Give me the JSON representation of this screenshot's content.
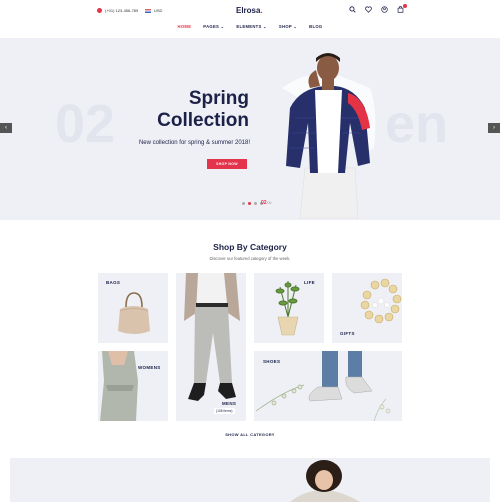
{
  "topbar": {
    "phone": "(+01) 123-456-789",
    "currency": "USD"
  },
  "brand": {
    "name": "Elrosa",
    "dot": "."
  },
  "header_icons": [
    "search-icon",
    "heart-icon",
    "user-icon",
    "cart-icon"
  ],
  "nav": [
    {
      "label": "HOME",
      "active": true
    },
    {
      "label": "PAGES ⌄"
    },
    {
      "label": "ELEMENTS ⌄"
    },
    {
      "label": "SHOP ⌄"
    },
    {
      "label": "BLOG"
    }
  ],
  "hero": {
    "bg_left": "02",
    "bg_right": "en",
    "title_line1": "Spring",
    "title_line2": "Collection",
    "subtitle": "New collection for spring & summer 2018!",
    "button": "SHOP NOW",
    "page_current": "02",
    "page_total": "/06"
  },
  "category": {
    "title": "Shop By Category",
    "subtitle": "Discover our featured category of the week.",
    "tiles": {
      "bags": "BAGS",
      "life": "LIFE",
      "gifts": "GIFTS",
      "women": "WOMENS",
      "shoes": "SHOES",
      "mens": "MENS",
      "mens_items": "(108 items)"
    },
    "show_all": "SHOW ALL CATEGORY"
  },
  "colors": {
    "accent": "#e4344b",
    "navy": "#1c2147",
    "panel": "#eef0f6"
  }
}
